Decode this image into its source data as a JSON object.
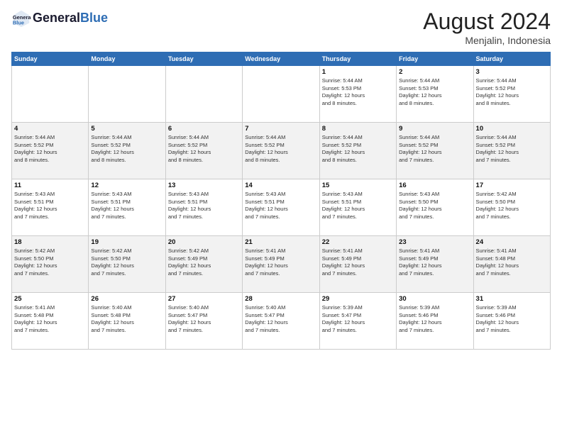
{
  "header": {
    "title": "August 2024",
    "location": "Menjalin, Indonesia",
    "logo_general": "General",
    "logo_blue": "Blue"
  },
  "days_of_week": [
    "Sunday",
    "Monday",
    "Tuesday",
    "Wednesday",
    "Thursday",
    "Friday",
    "Saturday"
  ],
  "weeks": [
    [
      {
        "day": "",
        "info": ""
      },
      {
        "day": "",
        "info": ""
      },
      {
        "day": "",
        "info": ""
      },
      {
        "day": "",
        "info": ""
      },
      {
        "day": "1",
        "info": "Sunrise: 5:44 AM\nSunset: 5:53 PM\nDaylight: 12 hours\nand 8 minutes."
      },
      {
        "day": "2",
        "info": "Sunrise: 5:44 AM\nSunset: 5:53 PM\nDaylight: 12 hours\nand 8 minutes."
      },
      {
        "day": "3",
        "info": "Sunrise: 5:44 AM\nSunset: 5:52 PM\nDaylight: 12 hours\nand 8 minutes."
      }
    ],
    [
      {
        "day": "4",
        "info": "Sunrise: 5:44 AM\nSunset: 5:52 PM\nDaylight: 12 hours\nand 8 minutes."
      },
      {
        "day": "5",
        "info": "Sunrise: 5:44 AM\nSunset: 5:52 PM\nDaylight: 12 hours\nand 8 minutes."
      },
      {
        "day": "6",
        "info": "Sunrise: 5:44 AM\nSunset: 5:52 PM\nDaylight: 12 hours\nand 8 minutes."
      },
      {
        "day": "7",
        "info": "Sunrise: 5:44 AM\nSunset: 5:52 PM\nDaylight: 12 hours\nand 8 minutes."
      },
      {
        "day": "8",
        "info": "Sunrise: 5:44 AM\nSunset: 5:52 PM\nDaylight: 12 hours\nand 8 minutes."
      },
      {
        "day": "9",
        "info": "Sunrise: 5:44 AM\nSunset: 5:52 PM\nDaylight: 12 hours\nand 7 minutes."
      },
      {
        "day": "10",
        "info": "Sunrise: 5:44 AM\nSunset: 5:52 PM\nDaylight: 12 hours\nand 7 minutes."
      }
    ],
    [
      {
        "day": "11",
        "info": "Sunrise: 5:43 AM\nSunset: 5:51 PM\nDaylight: 12 hours\nand 7 minutes."
      },
      {
        "day": "12",
        "info": "Sunrise: 5:43 AM\nSunset: 5:51 PM\nDaylight: 12 hours\nand 7 minutes."
      },
      {
        "day": "13",
        "info": "Sunrise: 5:43 AM\nSunset: 5:51 PM\nDaylight: 12 hours\nand 7 minutes."
      },
      {
        "day": "14",
        "info": "Sunrise: 5:43 AM\nSunset: 5:51 PM\nDaylight: 12 hours\nand 7 minutes."
      },
      {
        "day": "15",
        "info": "Sunrise: 5:43 AM\nSunset: 5:51 PM\nDaylight: 12 hours\nand 7 minutes."
      },
      {
        "day": "16",
        "info": "Sunrise: 5:43 AM\nSunset: 5:50 PM\nDaylight: 12 hours\nand 7 minutes."
      },
      {
        "day": "17",
        "info": "Sunrise: 5:42 AM\nSunset: 5:50 PM\nDaylight: 12 hours\nand 7 minutes."
      }
    ],
    [
      {
        "day": "18",
        "info": "Sunrise: 5:42 AM\nSunset: 5:50 PM\nDaylight: 12 hours\nand 7 minutes."
      },
      {
        "day": "19",
        "info": "Sunrise: 5:42 AM\nSunset: 5:50 PM\nDaylight: 12 hours\nand 7 minutes."
      },
      {
        "day": "20",
        "info": "Sunrise: 5:42 AM\nSunset: 5:49 PM\nDaylight: 12 hours\nand 7 minutes."
      },
      {
        "day": "21",
        "info": "Sunrise: 5:41 AM\nSunset: 5:49 PM\nDaylight: 12 hours\nand 7 minutes."
      },
      {
        "day": "22",
        "info": "Sunrise: 5:41 AM\nSunset: 5:49 PM\nDaylight: 12 hours\nand 7 minutes."
      },
      {
        "day": "23",
        "info": "Sunrise: 5:41 AM\nSunset: 5:49 PM\nDaylight: 12 hours\nand 7 minutes."
      },
      {
        "day": "24",
        "info": "Sunrise: 5:41 AM\nSunset: 5:48 PM\nDaylight: 12 hours\nand 7 minutes."
      }
    ],
    [
      {
        "day": "25",
        "info": "Sunrise: 5:41 AM\nSunset: 5:48 PM\nDaylight: 12 hours\nand 7 minutes."
      },
      {
        "day": "26",
        "info": "Sunrise: 5:40 AM\nSunset: 5:48 PM\nDaylight: 12 hours\nand 7 minutes."
      },
      {
        "day": "27",
        "info": "Sunrise: 5:40 AM\nSunset: 5:47 PM\nDaylight: 12 hours\nand 7 minutes."
      },
      {
        "day": "28",
        "info": "Sunrise: 5:40 AM\nSunset: 5:47 PM\nDaylight: 12 hours\nand 7 minutes."
      },
      {
        "day": "29",
        "info": "Sunrise: 5:39 AM\nSunset: 5:47 PM\nDaylight: 12 hours\nand 7 minutes."
      },
      {
        "day": "30",
        "info": "Sunrise: 5:39 AM\nSunset: 5:46 PM\nDaylight: 12 hours\nand 7 minutes."
      },
      {
        "day": "31",
        "info": "Sunrise: 5:39 AM\nSunset: 5:46 PM\nDaylight: 12 hours\nand 7 minutes."
      }
    ]
  ]
}
